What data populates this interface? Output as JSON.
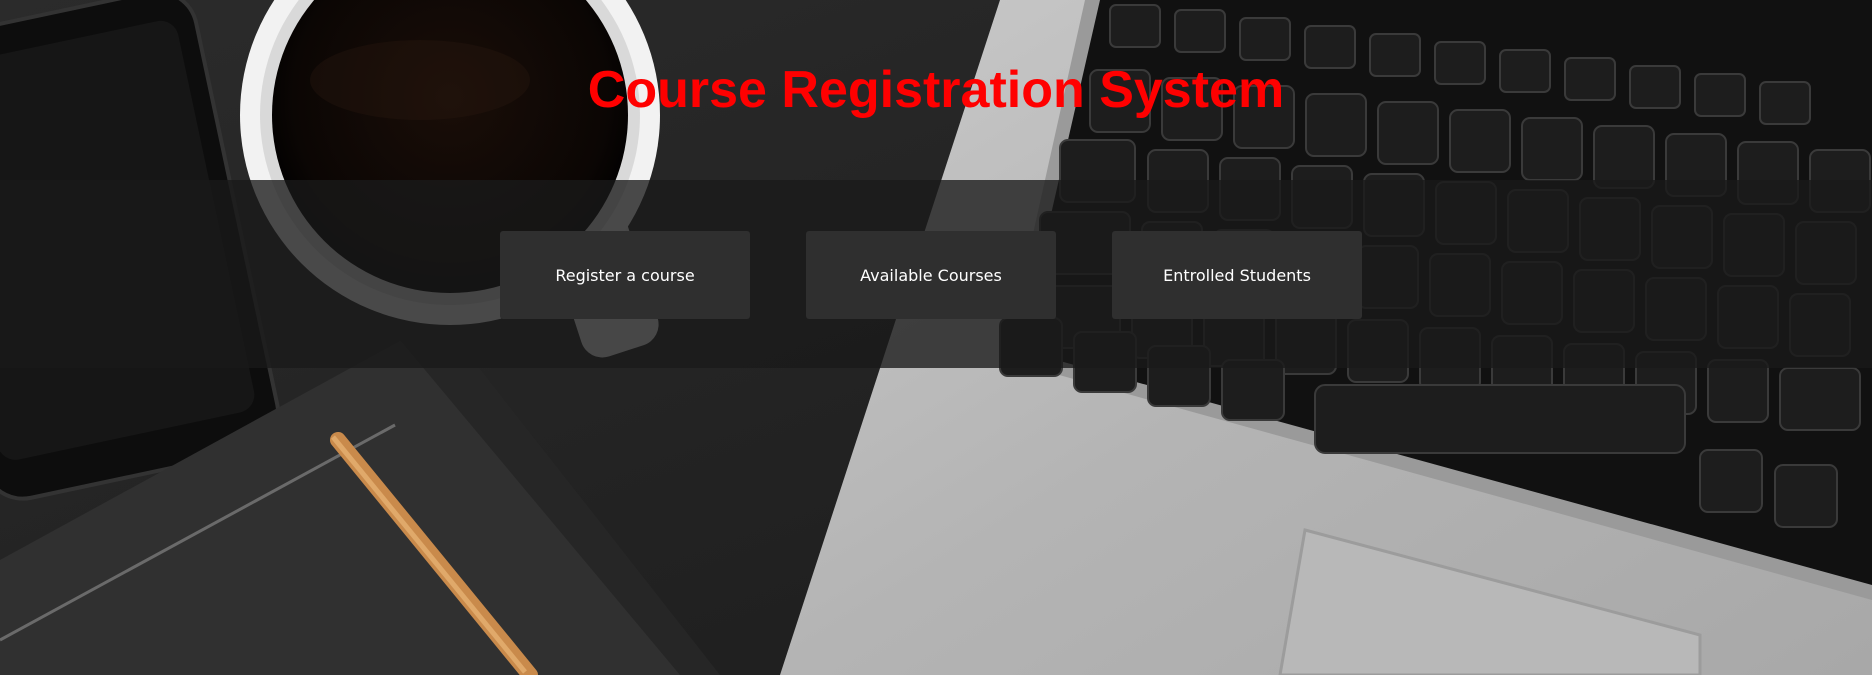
{
  "header": {
    "title": "Course Registration System",
    "title_color": "#ff0000"
  },
  "nav": {
    "items": [
      {
        "label": "Register a course"
      },
      {
        "label": "Available Courses"
      },
      {
        "label": "Entrolled Students"
      }
    ],
    "button_color": "#2f2f2f"
  },
  "background": {
    "description_icon": "desk-workspace-photo"
  }
}
